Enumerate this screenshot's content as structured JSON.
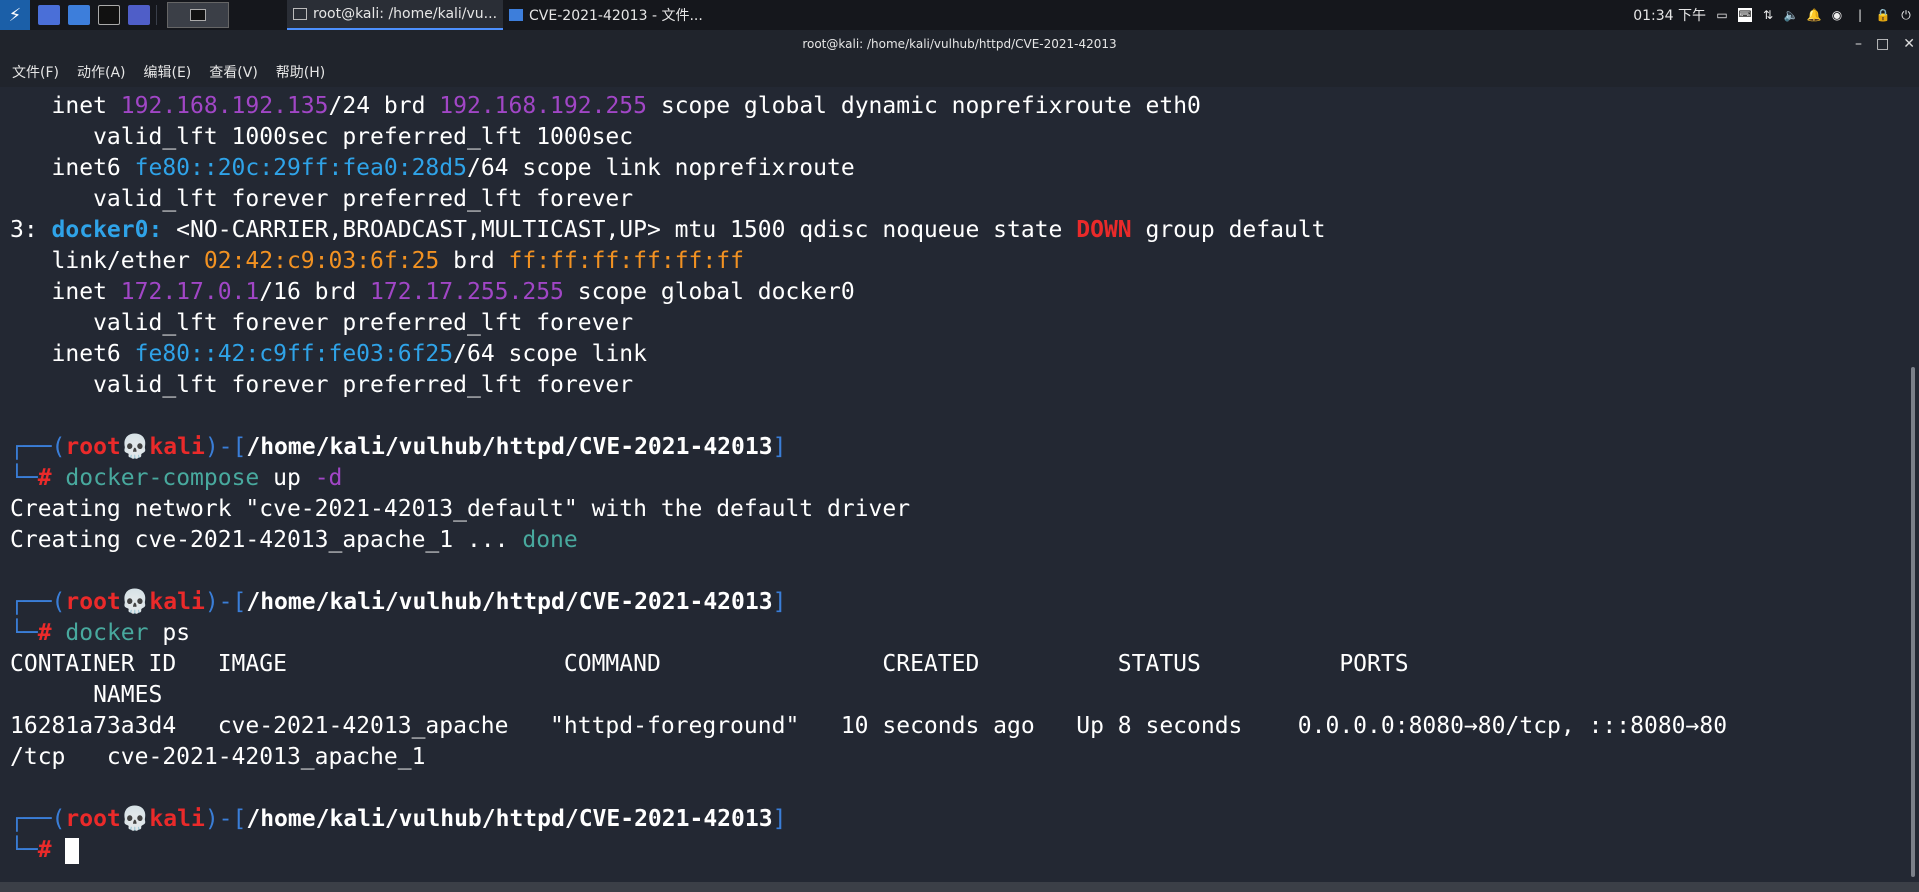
{
  "panel": {
    "window1_title": "root@kali: /home/kali/vu...",
    "window2_title": "CVE-2021-42013 - 文件...",
    "clock": "01:34 下午"
  },
  "titlebar": {
    "title": "root@kali: /home/kali/vulhub/httpd/CVE-2021-42013"
  },
  "menu": {
    "file": "文件(F)",
    "action": "动作(A)",
    "edit": "编辑(E)",
    "view": "查看(V)",
    "help": "帮助(H)"
  },
  "terminal": {
    "l1": {
      "a": "   inet ",
      "ip": "192.168.192.135",
      "b": "/24 brd ",
      "brd": "192.168.192.255",
      "c": " scope global dynamic noprefixroute eth0"
    },
    "l2": "      valid_lft 1000sec preferred_lft 1000sec",
    "l3": {
      "a": "   inet6 ",
      "ip6": "fe80::20c:29ff:fea0:28d5",
      "b": "/64 scope link noprefixroute"
    },
    "l4": "      valid_lft forever preferred_lft forever",
    "l5": {
      "a": "3: ",
      "iface": "docker0:",
      "b": " <NO-CARRIER,BROADCAST,MULTICAST,UP> mtu 1500 qdisc noqueue state ",
      "state": "DOWN",
      "c": " group default"
    },
    "l6": {
      "a": "   link/ether ",
      "mac": "02:42:c9:03:6f:25",
      "b": " brd ",
      "bmac": "ff:ff:ff:ff:ff:ff"
    },
    "l7": {
      "a": "   inet ",
      "ip": "172.17.0.1",
      "b": "/16 brd ",
      "brd": "172.17.255.255",
      "c": " scope global docker0"
    },
    "l8": "      valid_lft forever preferred_lft forever",
    "l9": {
      "a": "   inet6 ",
      "ip6": "fe80::42:c9ff:fe03:6f25",
      "b": "/64 scope link"
    },
    "l10": "      valid_lft forever preferred_lft forever",
    "prompt": {
      "open": "┌──(",
      "user": "root",
      "skull": "💀",
      "host": "kali",
      "mid": ")-[",
      "path": "/home/kali/vulhub/httpd/CVE-2021-42013",
      "close": "]",
      "corner": "└─",
      "hash": "#"
    },
    "cmd1": {
      "cmd": "docker-compose",
      "rest": " up ",
      "flag": "-d"
    },
    "out1": "Creating network \"cve-2021-42013_default\" with the default driver",
    "out2": {
      "a": "Creating cve-2021-42013_apache_1 ... ",
      "done": "done"
    },
    "cmd2": {
      "cmd": "docker",
      "rest": " ps"
    },
    "ps_header": "CONTAINER ID   IMAGE                    COMMAND                CREATED          STATUS          PORTS",
    "ps_header2": "      NAMES",
    "ps_row": "16281a73a3d4   cve-2021-42013_apache   \"httpd-foreground\"   10 seconds ago   Up 8 seconds    0.0.0.0:8080→80/tcp, :::8080→80",
    "ps_row2": "/tcp   cve-2021-42013_apache_1"
  }
}
